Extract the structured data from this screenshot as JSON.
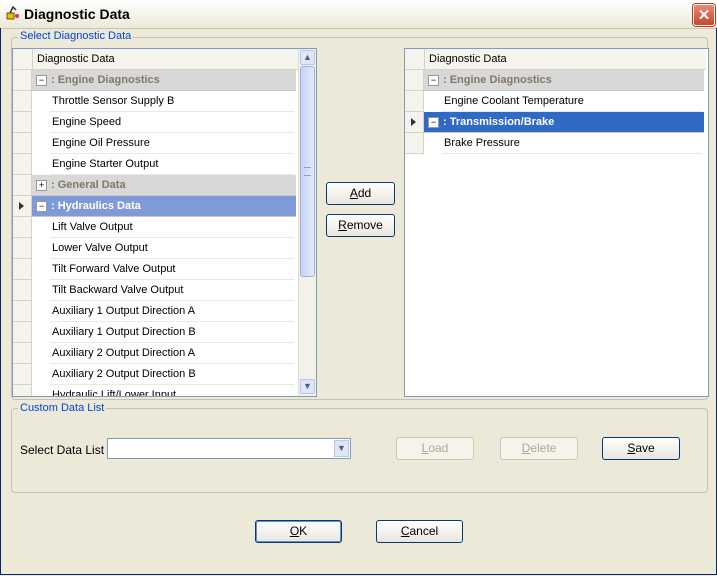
{
  "window": {
    "title": "Diagnostic Data",
    "close_icon": "close-icon"
  },
  "select_group": {
    "legend": "Select Diagnostic Data"
  },
  "left_grid": {
    "header": "Diagnostic Data",
    "rows": [
      {
        "type": "group",
        "label": ": Engine Diagnostics",
        "expander": "−",
        "state": "normal"
      },
      {
        "type": "item",
        "label": "Throttle Sensor Supply B"
      },
      {
        "type": "item",
        "label": "Engine Speed"
      },
      {
        "type": "item",
        "label": "Engine Oil Pressure"
      },
      {
        "type": "item",
        "label": "Engine Starter Output"
      },
      {
        "type": "group",
        "label": ": General Data",
        "expander": "+",
        "state": "normal"
      },
      {
        "type": "group",
        "label": ": Hydraulics Data",
        "expander": "−",
        "state": "highlighted",
        "current": true
      },
      {
        "type": "item",
        "label": "Lift Valve Output"
      },
      {
        "type": "item",
        "label": "Lower Valve Output"
      },
      {
        "type": "item",
        "label": "Tilt Forward Valve Output"
      },
      {
        "type": "item",
        "label": "Tilt Backward Valve Output"
      },
      {
        "type": "item",
        "label": "Auxiliary 1 Output Direction A"
      },
      {
        "type": "item",
        "label": "Auxiliary 1 Output Direction B"
      },
      {
        "type": "item",
        "label": "Auxiliary 2 Output Direction A"
      },
      {
        "type": "item",
        "label": "Auxiliary 2 Output Direction B"
      },
      {
        "type": "item",
        "label": "Hydraulic Lift/Lower Input"
      }
    ],
    "scroll_up_icon": "chevron-up-icon",
    "scroll_down_icon": "chevron-down-icon",
    "grip_icon": "grip-icon"
  },
  "right_grid": {
    "header": "Diagnostic Data",
    "rows": [
      {
        "type": "group",
        "label": ": Engine Diagnostics",
        "expander": "−",
        "state": "normal"
      },
      {
        "type": "item",
        "label": "Engine Coolant Temperature"
      },
      {
        "type": "group",
        "label": ": Transmission/Brake",
        "expander": "−",
        "state": "selected",
        "current": true
      },
      {
        "type": "item",
        "label": "Brake Pressure"
      }
    ]
  },
  "buttons": {
    "add": {
      "mnemonic": "A",
      "rest": "dd"
    },
    "remove": {
      "mnemonic": "R",
      "rest": "emove"
    },
    "load": {
      "mnemonic": "L",
      "rest": "oad"
    },
    "delete": {
      "mnemonic": "D",
      "rest": "elete"
    },
    "save": {
      "mnemonic": "S",
      "rest": "ave"
    },
    "ok": {
      "mnemonic": "O",
      "rest": "K"
    },
    "cancel": {
      "mnemonic": "C",
      "rest": "ancel"
    }
  },
  "custom_group": {
    "legend": "Custom Data List",
    "select_label": "Select Data List",
    "select_value": ""
  }
}
